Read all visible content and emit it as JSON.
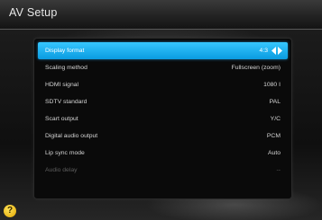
{
  "window": {
    "title": "AV Setup"
  },
  "menu": {
    "items": [
      {
        "label": "Display format",
        "value": "4:3"
      },
      {
        "label": "Scaling method",
        "value": "Fullscreen (zoom)"
      },
      {
        "label": "HDMI signal",
        "value": "1080 I"
      },
      {
        "label": "SDTV standard",
        "value": "PAL"
      },
      {
        "label": "Scart output",
        "value": "Y/C"
      },
      {
        "label": "Digital audio output",
        "value": "PCM"
      },
      {
        "label": "Lip sync mode",
        "value": "Auto"
      },
      {
        "label": "Audio delay",
        "value": "--"
      }
    ]
  },
  "footer": {
    "help_icon": "help-icon",
    "help_glyph": "?"
  },
  "colors": {
    "accent": "#1ab0f0",
    "background": "#0e0e0e"
  }
}
